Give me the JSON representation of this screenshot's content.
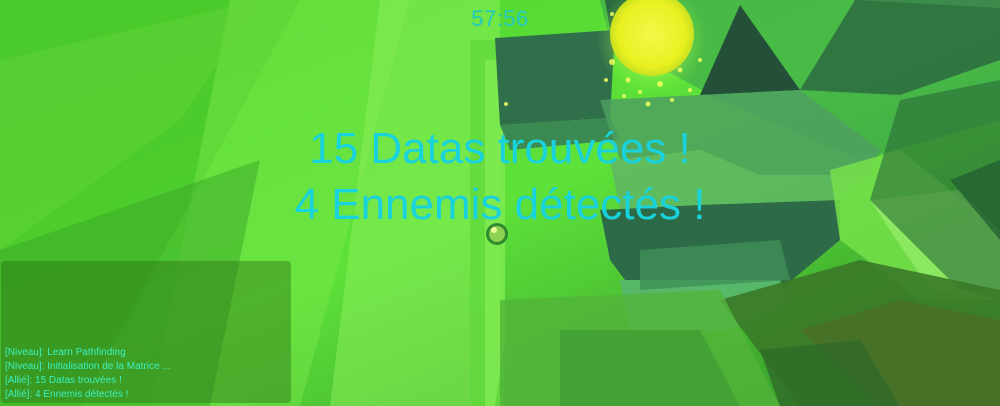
{
  "hud": {
    "timer": "57:56"
  },
  "announcement": {
    "line1": "15 Datas trouvées !",
    "line2": "4 Ennemis détectés !"
  },
  "chat": {
    "messages": [
      "[Niveau]: Learn Pathfinding",
      "[Niveau]: Initialisation de la Matrice ...",
      "[Allié]: 15 Datas trouvées !",
      "[Allié]: 4 Ennemis détectés !"
    ]
  },
  "colors": {
    "text_accent": "#19d3dc",
    "chat_text": "#3ff0c0",
    "scene_base": "#3fbf2a"
  }
}
